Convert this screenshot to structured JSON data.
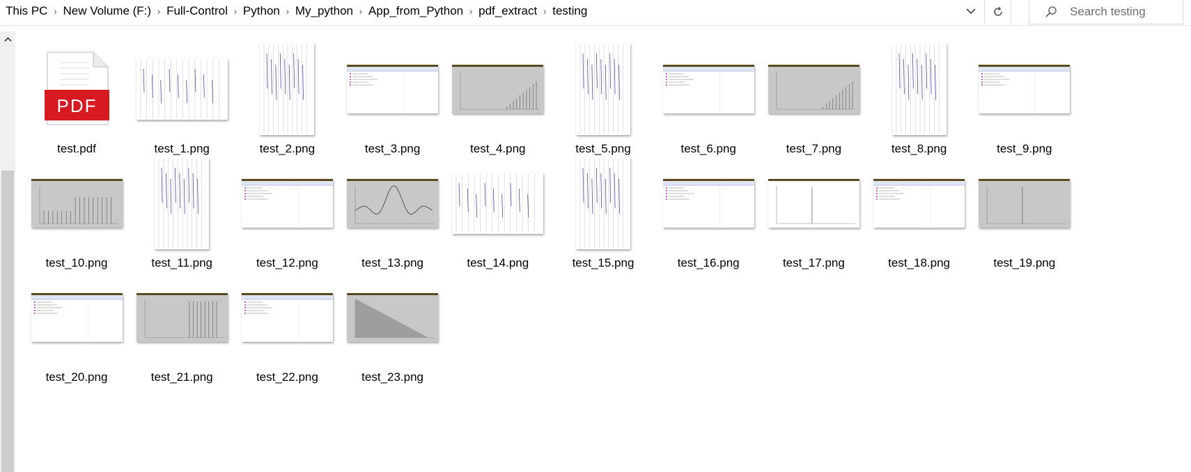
{
  "breadcrumb": [
    "This PC",
    "New Volume (F:)",
    "Full-Control",
    "Python",
    "My_python",
    "App_from_Python",
    "pdf_extract",
    "testing"
  ],
  "search": {
    "placeholder": "Search testing",
    "value": ""
  },
  "icons": {
    "dropdown": "chevron-down-icon",
    "refresh": "refresh-icon",
    "search": "search-icon",
    "scroll_up": "chevron-up-icon"
  },
  "pdf_icon_text": "PDF",
  "colors": {
    "pdf_red": "#d71921",
    "scroll_thumb": "#cdcdcd",
    "chart_grey": "#c8c8c8"
  },
  "files": [
    {
      "name": "test.pdf",
      "kind": "pdf"
    },
    {
      "name": "test_1.png",
      "kind": "notes-landscape"
    },
    {
      "name": "test_2.png",
      "kind": "notes-portrait"
    },
    {
      "name": "test_3.png",
      "kind": "screen"
    },
    {
      "name": "test_4.png",
      "kind": "chart-rising-bars"
    },
    {
      "name": "test_5.png",
      "kind": "notes-portrait"
    },
    {
      "name": "test_6.png",
      "kind": "screen"
    },
    {
      "name": "test_7.png",
      "kind": "chart-rising-bars"
    },
    {
      "name": "test_8.png",
      "kind": "notes-portrait"
    },
    {
      "name": "test_9.png",
      "kind": "screen"
    },
    {
      "name": "test_10.png",
      "kind": "chart-step"
    },
    {
      "name": "test_11.png",
      "kind": "notes-portrait"
    },
    {
      "name": "test_12.png",
      "kind": "screen"
    },
    {
      "name": "test_13.png",
      "kind": "chart-sinc"
    },
    {
      "name": "test_14.png",
      "kind": "notes-landscape"
    },
    {
      "name": "test_15.png",
      "kind": "notes-portrait"
    },
    {
      "name": "test_16.png",
      "kind": "screen"
    },
    {
      "name": "test_17.png",
      "kind": "chart-spike-white"
    },
    {
      "name": "test_18.png",
      "kind": "screen"
    },
    {
      "name": "test_19.png",
      "kind": "chart-spike"
    },
    {
      "name": "test_20.png",
      "kind": "screen"
    },
    {
      "name": "test_21.png",
      "kind": "chart-right-bars"
    },
    {
      "name": "test_22.png",
      "kind": "screen"
    },
    {
      "name": "test_23.png",
      "kind": "chart-triangle"
    }
  ]
}
